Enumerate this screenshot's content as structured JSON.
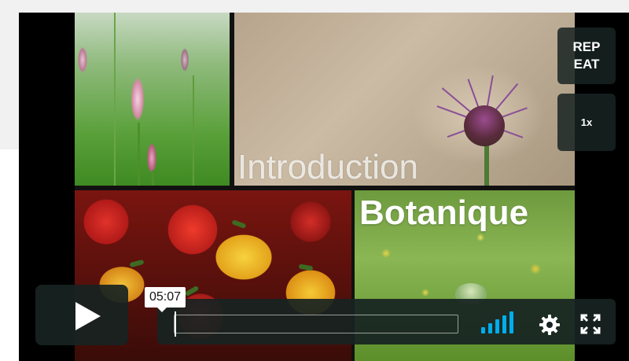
{
  "player": {
    "slides": {
      "tile_intro_text": "Introduction",
      "tile_botanique_text": "Botanique"
    },
    "controls": {
      "repeat_label": "REPEAT",
      "speed_label": "1x",
      "timestamp": "05:07",
      "progress_fraction": 0.0,
      "volume_level_fraction": 1.0,
      "play_icon": "play-icon",
      "volume_icon": "volume-bars-icon",
      "settings_icon": "gear-icon",
      "fullscreen_icon": "fullscreen-icon"
    },
    "colors": {
      "controls_bg": "#172322",
      "accent": "#00adef",
      "player_bg": "#000000"
    }
  }
}
